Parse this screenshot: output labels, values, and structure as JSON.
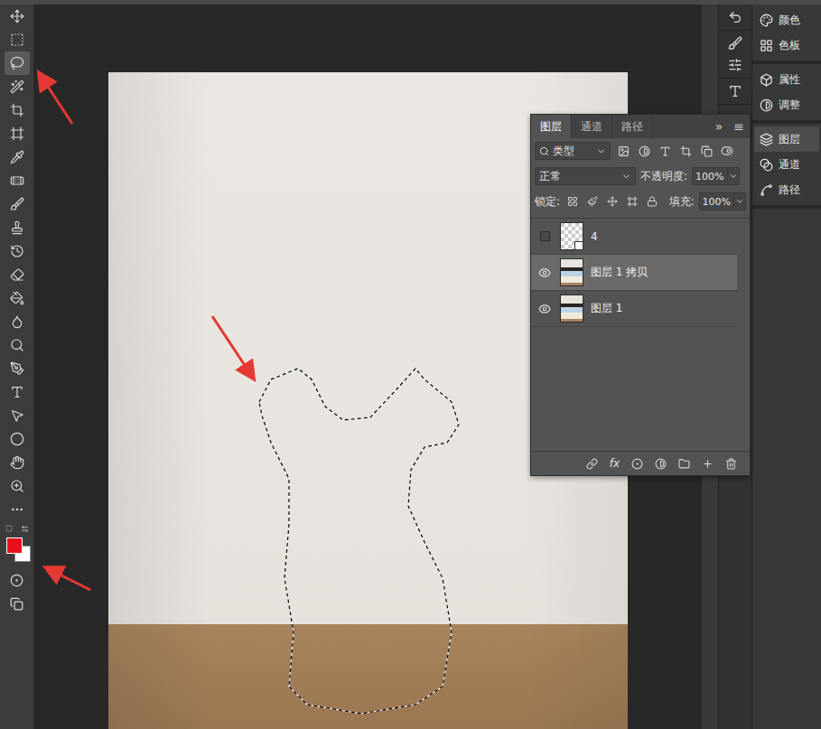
{
  "toolbar": {
    "tools": [
      {
        "selected": false
      },
      {
        "selected": false
      },
      {
        "selected": true
      },
      {
        "selected": false
      },
      {
        "selected": false
      },
      {
        "selected": false
      },
      {
        "selected": false
      },
      {
        "selected": false
      },
      {
        "selected": false
      },
      {
        "selected": false
      },
      {
        "selected": false
      },
      {
        "selected": false
      },
      {
        "selected": false
      },
      {
        "selected": false
      },
      {
        "selected": false
      },
      {
        "selected": false
      },
      {
        "selected": false
      },
      {
        "selected": false
      },
      {
        "selected": false
      },
      {
        "selected": false
      },
      {
        "selected": false
      },
      {
        "selected": false
      }
    ],
    "colors": {
      "foreground": "#e8101c",
      "background": "#ffffff"
    }
  },
  "dock": {
    "groups": [
      {
        "items": [
          {
            "label": "颜色",
            "selected": false
          },
          {
            "label": "色板",
            "selected": false
          }
        ]
      },
      {
        "items": [
          {
            "label": "属性",
            "selected": false
          },
          {
            "label": "调整",
            "selected": false
          }
        ]
      },
      {
        "items": [
          {
            "label": "图层",
            "selected": true
          },
          {
            "label": "通道",
            "selected": false
          },
          {
            "label": "路径",
            "selected": false
          }
        ]
      }
    ]
  },
  "layers_panel": {
    "tabs": [
      {
        "label": "图层",
        "selected": true
      },
      {
        "label": "通道",
        "selected": false
      },
      {
        "label": "路径",
        "selected": false
      }
    ],
    "overflow": "»",
    "menu": "≡",
    "filter": "类型",
    "blend_mode": "正常",
    "opacity_label": "不透明度:",
    "opacity": "100%",
    "lock_label": "锁定:",
    "fill_label": "填充:",
    "fill": "100%",
    "layers": [
      {
        "name": "4",
        "visible": false,
        "selected": false,
        "kind": "smart"
      },
      {
        "name": "图层 1 拷贝",
        "visible": true,
        "selected": true,
        "kind": "pixel"
      },
      {
        "name": "图层 1",
        "visible": true,
        "selected": false,
        "kind": "pixel"
      }
    ],
    "footer_fx": "fx"
  }
}
